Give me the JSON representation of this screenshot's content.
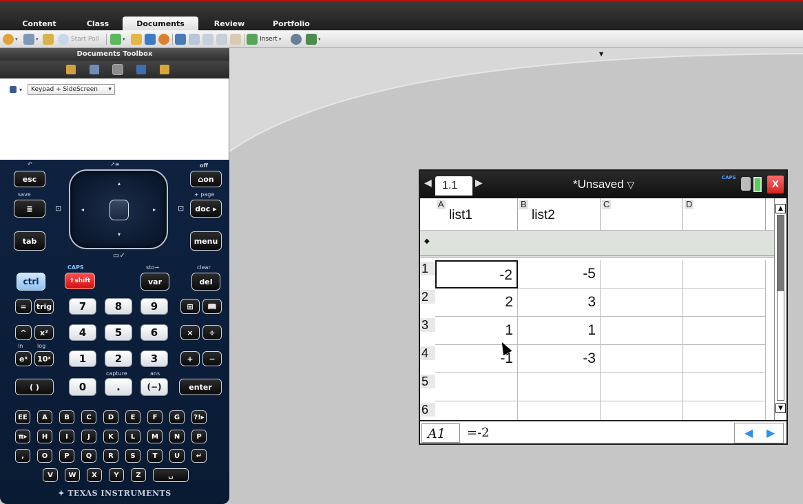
{
  "tabs": [
    "Content",
    "Class",
    "Documents",
    "Review",
    "Portfolio"
  ],
  "active_tab": "Documents",
  "toolbar": {
    "start_poll": "Start Poll",
    "insert": "Insert"
  },
  "toolbox": {
    "title": "Documents Toolbox",
    "view_mode": "Keypad + SideScreen"
  },
  "keypad": {
    "top_labels": {
      "undo": "↶",
      "off": "off",
      "save": "save",
      "page": "+ page",
      "scratch": "≡"
    },
    "esc": "esc",
    "on": "⌂on",
    "scratchpad": "≣",
    "doc": "doc ▸",
    "tab": "tab",
    "menu": "menu",
    "caps": "CAPS",
    "sto": "sto→",
    "clear": "clear",
    "ctrl": "ctrl",
    "shift": "⇧shift",
    "var": "var",
    "del": "del",
    "eq": "=",
    "trig": "trig",
    "pow": "^",
    "sq": "x²",
    "exp": "eˣ",
    "ten": "10ˣ",
    "paren": "( )",
    "n7": "7",
    "n8": "8",
    "n9": "9",
    "n4": "4",
    "n5": "5",
    "n6": "6",
    "n1": "1",
    "n2": "2",
    "n3": "3",
    "n0": "0",
    "dot": ".",
    "neg": "(−)",
    "tmpl": "⊞",
    "catalog": "📖",
    "mult": "×",
    "div": "÷",
    "plus": "+",
    "minus": "−",
    "enter": "enter",
    "capture": "capture",
    "ans": "ans",
    "ln": "ln",
    "log": "log",
    "letters_row1": [
      "EE",
      "A",
      "B",
      "C",
      "D",
      "E",
      "F",
      "G",
      "?!▸"
    ],
    "letters_row2": [
      "π▸",
      "H",
      "I",
      "J",
      "K",
      "L",
      "M",
      "N",
      "P"
    ],
    "letters_row3": [
      ",",
      "O",
      "P",
      "Q",
      "R",
      "S",
      "T",
      "U",
      "↵"
    ],
    "letters_row4": [
      "V",
      "W",
      "X",
      "Y",
      "Z",
      "␣"
    ],
    "brand": "TEXAS INSTRUMENTS"
  },
  "device": {
    "page_tab": "1.1",
    "doc_title": "*Unsaved",
    "caps_indicator": "CAPS",
    "close": "X",
    "columns": [
      {
        "letter": "A",
        "name": "list1"
      },
      {
        "letter": "B",
        "name": "list2"
      },
      {
        "letter": "C",
        "name": ""
      },
      {
        "letter": "D",
        "name": ""
      }
    ],
    "rows": [
      {
        "num": "1",
        "a": "-2",
        "b": "-5"
      },
      {
        "num": "2",
        "a": "2",
        "b": "3"
      },
      {
        "num": "3",
        "a": "1",
        "b": "1"
      },
      {
        "num": "4",
        "a": "-1",
        "b": "-3"
      },
      {
        "num": "5",
        "a": "",
        "b": ""
      },
      {
        "num": "6",
        "a": "",
        "b": ""
      }
    ],
    "selected_cell": "A1",
    "entry_formula": "=-2"
  }
}
